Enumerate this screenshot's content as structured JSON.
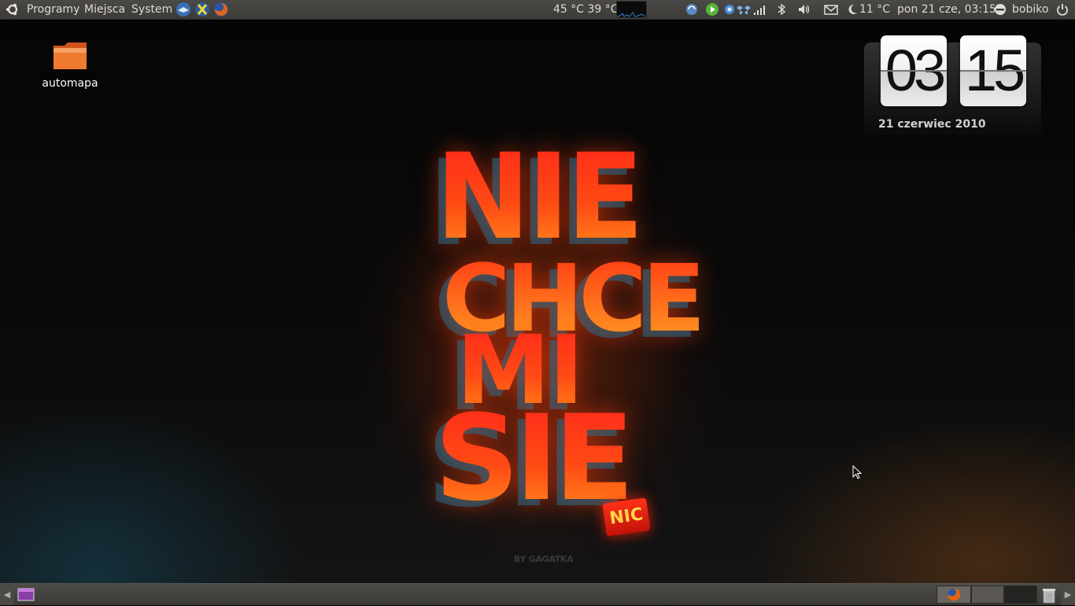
{
  "top_panel": {
    "menus": [
      {
        "label": "Programy"
      },
      {
        "label": "Miejsca"
      },
      {
        "label": "System"
      }
    ],
    "temps": "45 °C 39 °C",
    "weather_temp": "11 °C",
    "datetime": "pon 21 cze, 03:15",
    "user": "bobiko",
    "launchers": [
      "thunderbird-icon",
      "xchat-icon",
      "firefox-icon"
    ],
    "tray_icons": [
      "update-icon",
      "play-icon",
      "network-icon",
      "dropbox-icon",
      "signal-icon",
      "bluetooth-icon",
      "volume-icon",
      "mail-icon",
      "moon-icon",
      "user-status-icon",
      "power-icon"
    ]
  },
  "desktop": {
    "icons": [
      {
        "label": "automapa"
      }
    ]
  },
  "clock_widget": {
    "hours": "03",
    "minutes": "15",
    "date": "21 czerwiec 2010"
  },
  "wallpaper": {
    "lines": [
      "NIE",
      "CHCE",
      "MI",
      "SIE"
    ],
    "tag": "NIC",
    "credit": "BY GAGATKA"
  },
  "colors": {
    "panel": "#3c3b37",
    "accent_red": "#ff2a1a",
    "accent_orange": "#ff8a1a"
  }
}
